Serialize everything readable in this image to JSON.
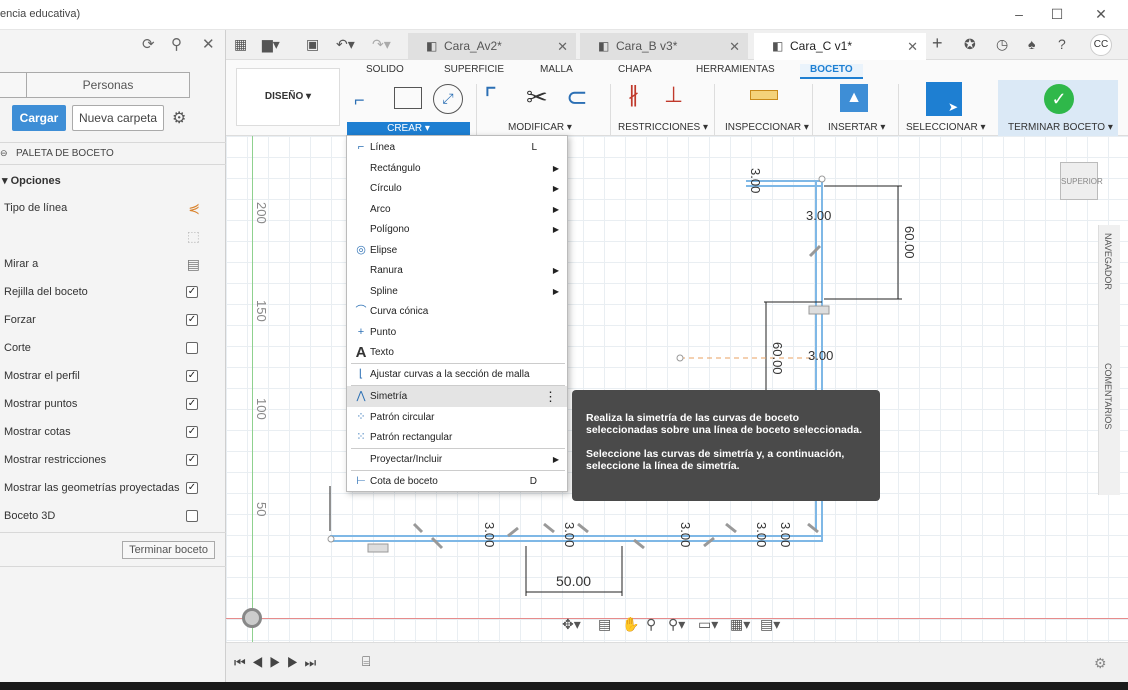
{
  "window": {
    "title": "encia educativa)",
    "min": "–",
    "max": "☐",
    "close": "✕"
  },
  "left": {
    "tabs": [
      "",
      "Personas"
    ],
    "upload_label": "Cargar",
    "new_folder_label": "Nueva carpeta",
    "palette_title": "PALETA DE BOCETO",
    "options_title": "▾ Opciones",
    "finish_label": "Terminar boceto",
    "rows": [
      {
        "label": "Tipo de línea",
        "kind": "icon",
        "icon": "line-type-icon"
      },
      {
        "label": "",
        "kind": "icon",
        "icon": "construction-icon"
      },
      {
        "label": "Mirar a",
        "kind": "icon",
        "icon": "look-at-icon"
      },
      {
        "label": "Rejilla del boceto",
        "kind": "check",
        "checked": true
      },
      {
        "label": "Forzar",
        "kind": "check",
        "checked": true
      },
      {
        "label": "Corte",
        "kind": "check",
        "checked": false
      },
      {
        "label": "Mostrar el perfil",
        "kind": "check",
        "checked": true
      },
      {
        "label": "Mostrar puntos",
        "kind": "check",
        "checked": true
      },
      {
        "label": "Mostrar cotas",
        "kind": "check",
        "checked": true
      },
      {
        "label": "Mostrar restricciones",
        "kind": "check",
        "checked": true
      },
      {
        "label": "Mostrar las geometrías proyectadas",
        "kind": "check",
        "checked": true
      },
      {
        "label": "Boceto 3D",
        "kind": "check",
        "checked": false
      }
    ]
  },
  "doctabs": [
    {
      "label": "Cara_Av2*",
      "active": false
    },
    {
      "label": "Cara_B v3*",
      "active": false
    },
    {
      "label": "Cara_C v1*",
      "active": true
    }
  ],
  "avatar": "CC",
  "ribbon": {
    "workspace": "DISEÑO ▾",
    "tabs": [
      "SOLIDO",
      "SUPERFICIE",
      "MALLA",
      "CHAPA",
      "HERRAMIENTAS",
      "BOCETO"
    ],
    "groups": [
      "CREAR ▾",
      "MODIFICAR ▾",
      "RESTRICCIONES ▾",
      "INSPECCIONAR ▾",
      "INSERTAR ▾",
      "SELECCIONAR ▾",
      "TERMINAR BOCETO ▾"
    ]
  },
  "menu": [
    {
      "label": "Línea",
      "icon": "line-icon",
      "glyph": "⌐",
      "shortcut": "L",
      "arrow": false
    },
    {
      "label": "Rectángulo",
      "icon": "",
      "glyph": "",
      "shortcut": "",
      "arrow": true
    },
    {
      "label": "Círculo",
      "icon": "",
      "glyph": "",
      "shortcut": "",
      "arrow": true
    },
    {
      "label": "Arco",
      "icon": "",
      "glyph": "",
      "shortcut": "",
      "arrow": true
    },
    {
      "label": "Polígono",
      "icon": "",
      "glyph": "",
      "shortcut": "",
      "arrow": true
    },
    {
      "label": "Elipse",
      "icon": "ellipse-icon",
      "glyph": "◎",
      "shortcut": "",
      "arrow": false
    },
    {
      "label": "Ranura",
      "icon": "",
      "glyph": "",
      "shortcut": "",
      "arrow": true
    },
    {
      "label": "Spline",
      "icon": "",
      "glyph": "",
      "shortcut": "",
      "arrow": true
    },
    {
      "label": "Curva cónica",
      "icon": "conic-icon",
      "glyph": "⌒",
      "shortcut": "",
      "arrow": false
    },
    {
      "label": "Punto",
      "icon": "point-icon",
      "glyph": "+",
      "shortcut": "",
      "arrow": false
    },
    {
      "label": "Texto",
      "icon": "text-icon",
      "glyph": "A",
      "shortcut": "",
      "arrow": false
    },
    {
      "label": "Ajustar curvas a la sección de malla",
      "icon": "fit-curves-icon",
      "glyph": "⌊",
      "shortcut": "",
      "arrow": false
    },
    {
      "label": "Simetría",
      "icon": "mirror-icon",
      "glyph": "⋀",
      "shortcut": "⋮",
      "arrow": false
    },
    {
      "label": "Patrón circular",
      "icon": "circular-pattern-icon",
      "glyph": "⁘",
      "shortcut": "",
      "arrow": false
    },
    {
      "label": "Patrón rectangular",
      "icon": "rect-pattern-icon",
      "glyph": "⁙",
      "shortcut": "",
      "arrow": false
    },
    {
      "label": "Proyectar/Incluir",
      "icon": "",
      "glyph": "",
      "shortcut": "",
      "arrow": true
    },
    {
      "label": "Cota de boceto",
      "icon": "dimension-icon",
      "glyph": "⊢",
      "shortcut": "D",
      "arrow": false
    }
  ],
  "tooltip": {
    "line1": "Realiza la simetría de las curvas de boceto seleccionadas sobre una línea de boceto seleccionada.",
    "line2": "Seleccione las curvas de simetría y, a continuación, seleccione la línea de simetría."
  },
  "ruler": [
    "200",
    "150",
    "100",
    "50"
  ],
  "dims": [
    "3.00",
    "3.00",
    "60.00",
    "60.00",
    "3.00",
    "3.00",
    "3.00",
    "3.00",
    "3.00",
    "3.00",
    "50.00"
  ],
  "viewcube": "SUPERIOR",
  "side": {
    "nav": "NAVEGADOR",
    "comments": "COMENTARIOS"
  },
  "colors": {
    "accent": "#1e7fd2",
    "sketch": "#7fb8e6",
    "finish": "#2fb84a"
  }
}
